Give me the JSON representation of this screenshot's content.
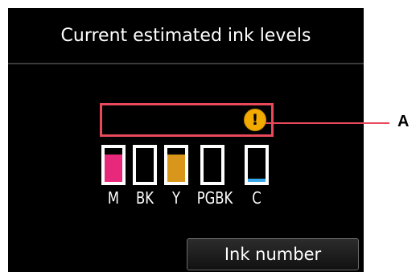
{
  "title": "Current estimated ink levels",
  "warning_icon": "exclamation-icon",
  "warning_glyph": "!",
  "tanks": [
    {
      "label": "M",
      "color": "#e8287a",
      "level": 0.8
    },
    {
      "label": "BK",
      "color": "#000000",
      "level": 0.0
    },
    {
      "label": "Y",
      "color": "#d8961a",
      "level": 0.8
    },
    {
      "label": "PGBK",
      "color": "#000000",
      "level": 0.0
    },
    {
      "label": "C",
      "color": "#38a8e8",
      "level": 0.1
    }
  ],
  "ink_number_button": "Ink number",
  "callout": "A",
  "colors": {
    "highlight": "#e84a5b",
    "warning": "#f2a900"
  }
}
